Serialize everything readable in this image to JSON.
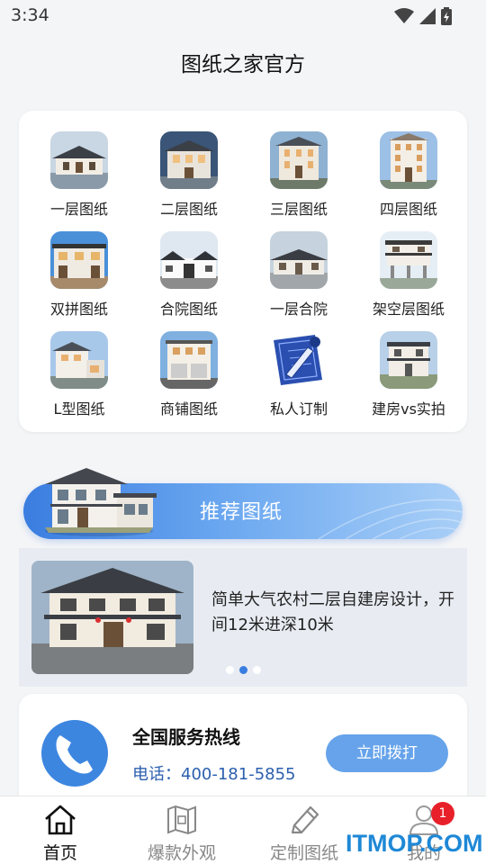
{
  "status_bar": {
    "time": "3:34"
  },
  "app": {
    "title": "图纸之家官方"
  },
  "categories": [
    {
      "label": "一层图纸",
      "icon": "house-1-icon"
    },
    {
      "label": "二层图纸",
      "icon": "house-2-icon"
    },
    {
      "label": "三层图纸",
      "icon": "house-3-icon"
    },
    {
      "label": "四层图纸",
      "icon": "house-4-icon"
    },
    {
      "label": "双拼图纸",
      "icon": "duplex-house-icon"
    },
    {
      "label": "合院图纸",
      "icon": "courtyard-house-icon"
    },
    {
      "label": "一层合院",
      "icon": "single-courtyard-icon"
    },
    {
      "label": "架空层图纸",
      "icon": "stilt-house-icon"
    },
    {
      "label": "L型图纸",
      "icon": "l-shape-house-icon"
    },
    {
      "label": "商铺图纸",
      "icon": "shop-house-icon"
    },
    {
      "label": "私人订制",
      "icon": "blueprint-icon"
    },
    {
      "label": "建房vs实拍",
      "icon": "photo-house-icon"
    }
  ],
  "recommend": {
    "title": "推荐图纸"
  },
  "carousel": {
    "text": "简单大气农村二层自建房设计，开间12米进深10米",
    "dots": 3,
    "active_index": 1
  },
  "hotline": {
    "title": "全国服务热线",
    "phone": "电话：400-181-5855",
    "call_label": "立即拨打"
  },
  "bottom_nav": [
    {
      "label": "首页",
      "icon": "home-icon",
      "active": true
    },
    {
      "label": "爆款外观",
      "icon": "map-icon",
      "active": false
    },
    {
      "label": "定制图纸",
      "icon": "pencil-icon",
      "active": false
    },
    {
      "label": "我的",
      "icon": "user-icon",
      "active": false,
      "badge": "1"
    }
  ],
  "watermark": "ITMOP.COM",
  "colors": {
    "accent": "#3a7de0",
    "badge": "#e8202a",
    "watermark": "#1e88d6"
  }
}
